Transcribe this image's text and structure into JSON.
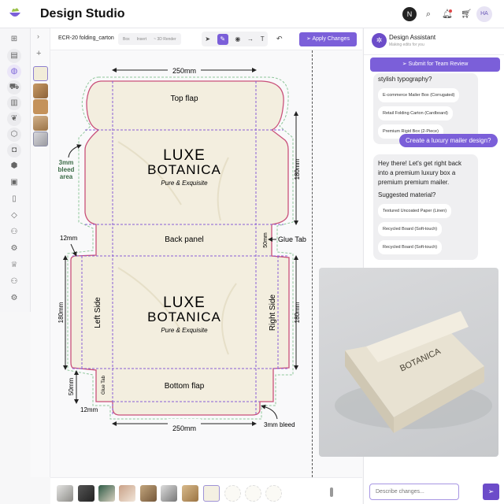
{
  "app": {
    "title": "Design Studio",
    "user_initial": "N",
    "avatar_initials": "HA"
  },
  "header_icons": [
    "search-icon",
    "bell-icon",
    "cart-icon"
  ],
  "rail_icons": [
    "grid-icon",
    "calendar-icon",
    "palette-icon",
    "truck-icon",
    "barcode-icon",
    "leaf-icon",
    "shield-icon",
    "camera-icon",
    "cube-icon",
    "book-icon",
    "file-icon",
    "tag-icon",
    "users-icon",
    "gear-icon",
    "crown-icon",
    "team-icon",
    "settings-icon"
  ],
  "toolbar": {
    "file_name": "ECR-20 folding_carton",
    "modes": [
      "Box",
      "Insert",
      "~ 3D Render"
    ],
    "tools": [
      "select",
      "pen",
      "paint",
      "arrow",
      "text"
    ],
    "undo": "undo",
    "apply": "Apply Changes"
  },
  "dieline": {
    "brand_line1": "LUXE",
    "brand_line2": "BOTANICA",
    "tagline": "Pure & Exquisite",
    "top_flap": "Top flap",
    "back_panel": "Back panel",
    "bottom_flap": "Bottom flap",
    "left_side": "Left Side",
    "right_side": "Right Side",
    "glue_tab": "Glue Tab",
    "glue_tab_small": "Glue Tab",
    "width_top": "250mm",
    "width_bottom": "250mm",
    "height_top": "180mm",
    "height_left": "180mm",
    "height_right": "180mm",
    "tab_50_right": "50mm",
    "tab_50_left": "50mm",
    "lip_12_top": "12mm",
    "lip_12_bottom": "12mm",
    "bleed_left": [
      "3mm",
      "bleed",
      "area"
    ],
    "bleed_bottom": "3mm bleed"
  },
  "colors": {
    "accent": "#7b5fd9",
    "cut_line": "#c9507a",
    "fold_line": "#8a5ed6",
    "bleed_line": "#8fc79b",
    "board": "#f3eedf"
  },
  "assistant": {
    "name": "Design Assistant",
    "status": "Making edits for you",
    "submit": "Submit for Team Review",
    "msg1_text": "stylish typography?",
    "msg1_chips": [
      "E-commerce Mailer Box (Corrugated)",
      "Retail Folding Carton (Cardboard)",
      "Premium Rigid Box (2-Piece)"
    ],
    "user_msg": "Create a luxury mailer design?",
    "msg2_text": "Hey there! Let's get right back into a premium luxury box a premium premium mailer.",
    "msg2_question": "Suggested material?",
    "msg2_chips": [
      "Textured Uncoated Paper (Linen)",
      "Recycled Board (Soft-touch)",
      "Recycled Board (Soft-touch)"
    ],
    "input_placeholder": "Describe changes..."
  }
}
